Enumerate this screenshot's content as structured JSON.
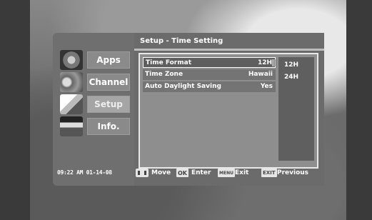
{
  "sidebar": {
    "items": [
      {
        "label": "Apps",
        "icon": "apps-thumbnail-icon"
      },
      {
        "label": "Channel",
        "icon": "channel-thumbnail-icon"
      },
      {
        "label": "Setup",
        "icon": "setup-thumbnail-icon"
      },
      {
        "label": "Info.",
        "icon": "info-thumbnail-icon"
      }
    ],
    "active": "Setup",
    "clock": "09:22 AM 01-14-08"
  },
  "panel": {
    "title": "Setup - Time Setting",
    "rows": [
      {
        "label": "Time Format",
        "value": "12H"
      },
      {
        "label": "Time Zone",
        "value": "Hawaii"
      },
      {
        "label": "Auto Daylight Saving",
        "value": "Yes"
      }
    ],
    "options": [
      "12H",
      "24H"
    ]
  },
  "footer": {
    "move_label": "Move",
    "ok_key": "OK",
    "enter_label": "Enter",
    "menu_key": "MENU",
    "exit_label": "Exit",
    "exit_key": "EXIT",
    "previous_label": "Previous"
  },
  "colors": {
    "panel_bg": "#6b6b6b",
    "content_bg": "#8e8e8e",
    "highlight_border": "#ffffff"
  }
}
